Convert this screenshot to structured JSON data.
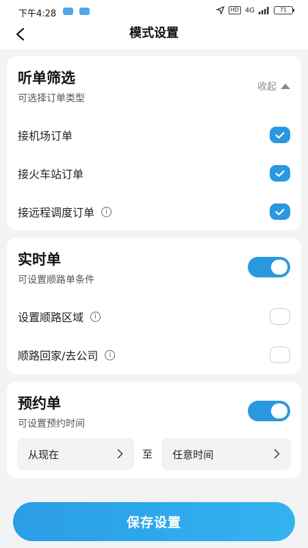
{
  "status": {
    "time": "下午4:28",
    "network": "4G",
    "hd": "HD",
    "battery": "71"
  },
  "header": {
    "title": "模式设置"
  },
  "filter": {
    "title": "听单筛选",
    "subtitle": "可选择订单类型",
    "collapse_label": "收起",
    "options": [
      {
        "label": "接机场订单",
        "checked": true
      },
      {
        "label": "接火车站订单",
        "checked": true
      },
      {
        "label": "接远程调度订单",
        "checked": true
      }
    ]
  },
  "realtime": {
    "title": "实时单",
    "subtitle": "可设置顺路单条件",
    "enabled": true,
    "options": [
      {
        "label": "设置顺路区域",
        "checked": false
      },
      {
        "label": "顺路回家/去公司",
        "checked": false
      }
    ]
  },
  "reservation": {
    "title": "预约单",
    "subtitle": "可设置预约时间",
    "enabled": true,
    "from_label": "从现在",
    "separator": "至",
    "to_label": "任意时间"
  },
  "footer": {
    "save_label": "保存设置"
  },
  "colors": {
    "accent": "#2a98e0",
    "background": "#f2f3f5",
    "card": "#ffffff"
  }
}
